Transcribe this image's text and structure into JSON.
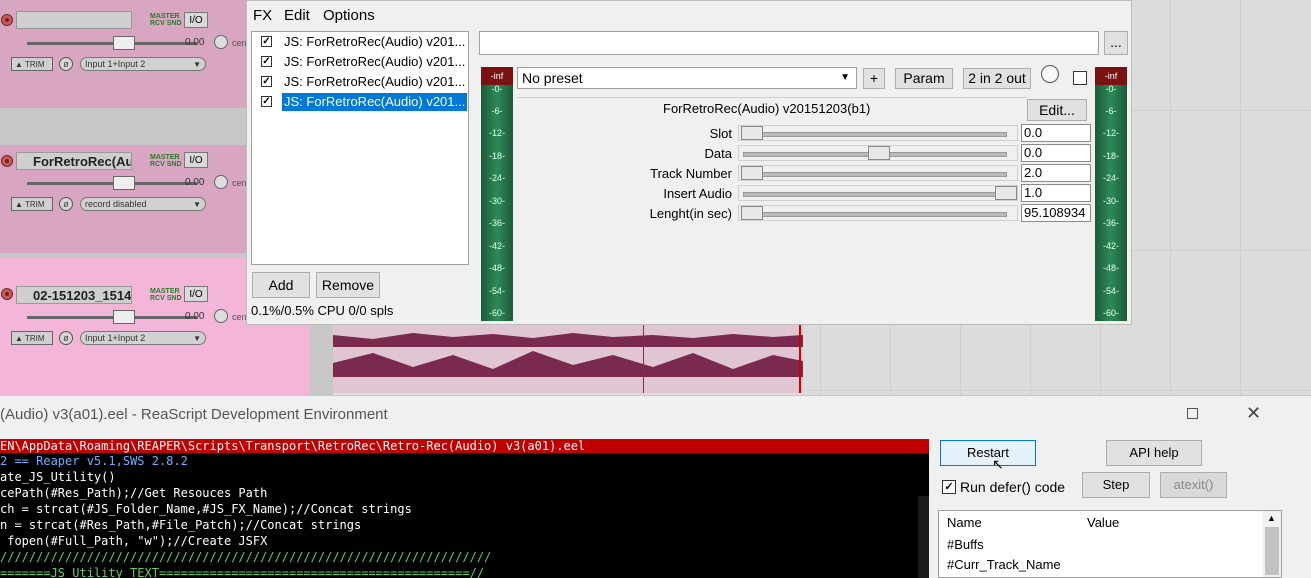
{
  "tracks": [
    {
      "name": "",
      "meter_label": "MASTER\nRCV SND",
      "io": "I/O",
      "volume": "0.00",
      "pan_label": "cen",
      "trim": "TRIM",
      "input": "Input 1+Input 2",
      "color": "#d8a6c0"
    },
    {
      "name": "ForRetroRec(Au",
      "meter_label": "MASTER\nRCV SND",
      "io": "I/O",
      "volume": "0.00",
      "pan_label": "cen",
      "trim": "TRIM",
      "input": "record disabled",
      "color": "#d8a6c0"
    },
    {
      "name": "02-151203_1514",
      "meter_label": "MASTER\nRCV SND",
      "io": "I/O",
      "volume": "0.00",
      "pan_label": "cen",
      "trim": "TRIM",
      "input": "Input 1+Input 2",
      "color": "#f3b6d8"
    }
  ],
  "fx_window": {
    "menu": [
      "FX",
      "Edit",
      "Options"
    ],
    "fx_chain": [
      {
        "label": "JS: ForRetroRec(Audio) v201...",
        "enabled": true,
        "selected": false
      },
      {
        "label": "JS: ForRetroRec(Audio) v201...",
        "enabled": true,
        "selected": false
      },
      {
        "label": "JS: ForRetroRec(Audio) v201...",
        "enabled": true,
        "selected": false
      },
      {
        "label": "JS: ForRetroRec(Audio) v201...",
        "enabled": true,
        "selected": true
      }
    ],
    "add_label": "Add",
    "remove_label": "Remove",
    "cpu_text": "0.1%/0.5% CPU 0/0 spls",
    "browse_label": "...",
    "preset": "No preset",
    "plus_label": "+",
    "param_label": "Param",
    "io_label": "2 in 2 out",
    "edit_label": "Edit...",
    "plugin_title": "ForRetroRec(Audio) v20151203(b1)",
    "meter_top": "-inf",
    "meter_scale": [
      "-0-",
      "-6-",
      "-12-",
      "-18-",
      "-24-",
      "-30-",
      "-36-",
      "-42-",
      "-48-",
      "-54-",
      "-60-"
    ],
    "params": [
      {
        "label": "Slot",
        "value": "0.0",
        "fraction": 0.0
      },
      {
        "label": "Data",
        "value": "0.0",
        "fraction": 0.5
      },
      {
        "label": "Track Number",
        "value": "2.0",
        "fraction": 0.0
      },
      {
        "label": "Insert Audio",
        "value": "1.0",
        "fraction": 1.0
      },
      {
        "label": "Lenght(in sec)",
        "value": "95.108934",
        "fraction": 0.0
      }
    ]
  },
  "ide": {
    "title": "(Audio) v3(a01).eel - ReaScript Development Environment",
    "path": "EN\\AppData\\Roaming\\REAPER\\Scripts\\Transport\\RetroRec\\Retro-Rec(Audio) v3(a01).eel",
    "code": [
      "2 == Reaper v5.1,SWS 2.8.2",
      "ate_JS_Utility()",
      "cePath(#Res_Path);//Get Resouces Path",
      "ch = strcat(#JS_Folder_Name,#JS_FX_Name);//Concat strings",
      "n = strcat(#Res_Path,#File_Patch);//Concat strings",
      " fopen(#Full_Path, \"w\");//Create JSFX",
      "////////////////////////////////////////////////////////////////////",
      "=======JS_Utility_TEXT===========================================//"
    ],
    "restart_label": "Restart",
    "api_help_label": "API help",
    "run_defer_label": "Run defer() code",
    "run_defer_checked": true,
    "step_label": "Step",
    "atexit_label": "atexit()",
    "var_headers": [
      "Name",
      "Value"
    ],
    "vars": [
      "#Buffs",
      "#Curr_Track_Name"
    ]
  }
}
